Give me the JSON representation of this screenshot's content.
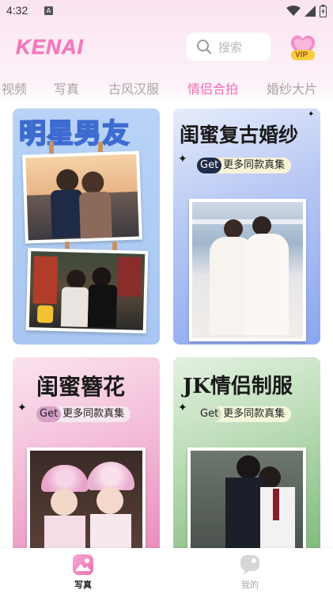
{
  "status_bar": {
    "time": "4:32",
    "notification_glyph": "A"
  },
  "header": {
    "logo": "KENAI",
    "search_placeholder": "搜索",
    "vip_label": "VIP"
  },
  "tabs": [
    {
      "label": "视频",
      "active": false
    },
    {
      "label": "写真",
      "active": false
    },
    {
      "label": "古风汉服",
      "active": false
    },
    {
      "label": "情侣合拍",
      "active": true
    },
    {
      "label": "婚纱大片",
      "active": false
    }
  ],
  "cards": [
    {
      "title": "明星男友"
    },
    {
      "title": "闺蜜复古婚纱",
      "pill": "更多同款真集",
      "pill_get": "Get"
    },
    {
      "title": "闺蜜簪花",
      "pill": "更多同款真集",
      "pill_get": "Get"
    },
    {
      "title": "JK情侣制服",
      "pill": "更多同款真集",
      "pill_get": "Get"
    }
  ],
  "bottom_nav": [
    {
      "label": "写真",
      "active": true,
      "icon": "image-icon"
    },
    {
      "label": "我的",
      "active": false,
      "icon": "chat-bubble-icon"
    }
  ],
  "colors": {
    "accent": "#f56ab5",
    "tab_inactive": "#a6a6a6"
  }
}
